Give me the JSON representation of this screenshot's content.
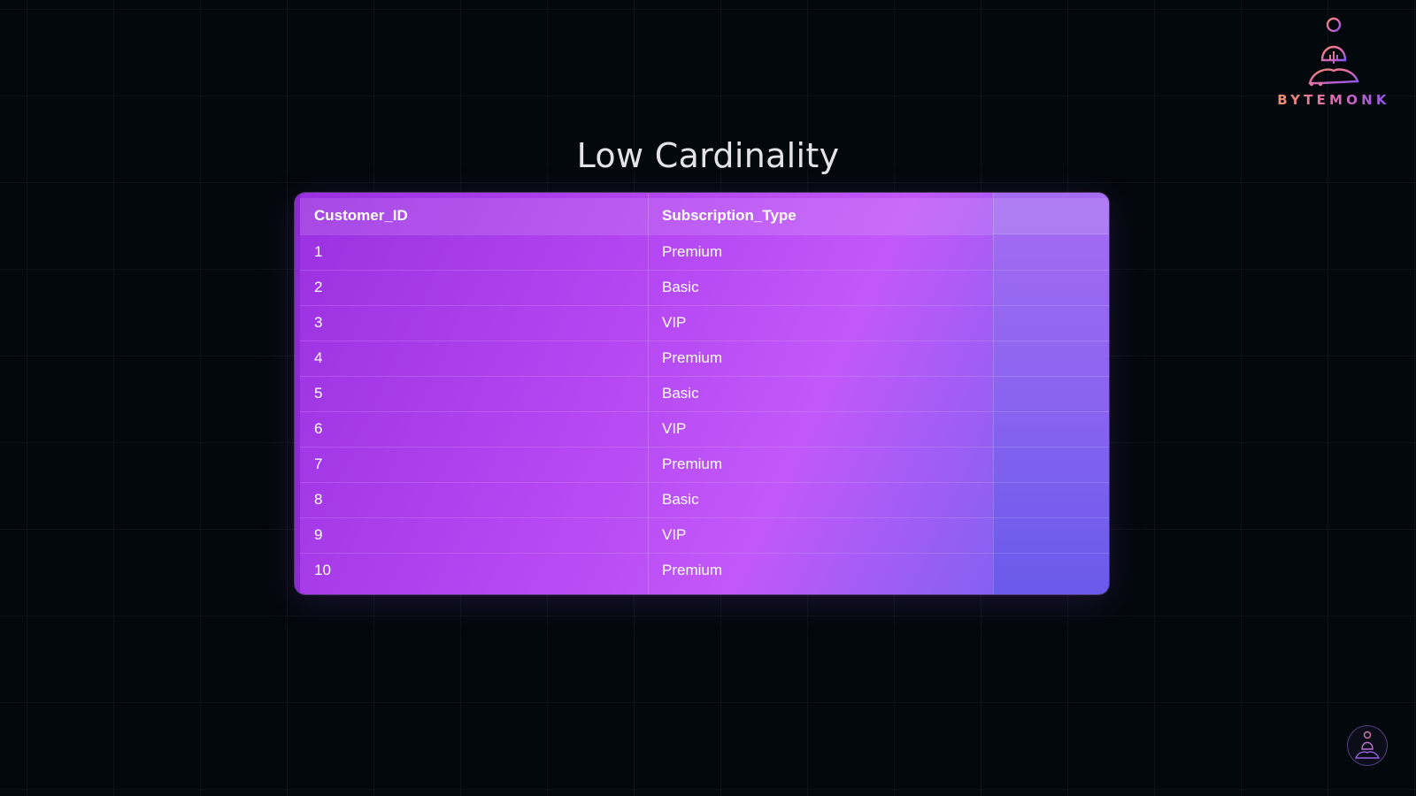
{
  "brand": {
    "wordmark": "BYTEMONK",
    "logo_icon": "meditating-monk-icon",
    "colors": [
      "#f0906a",
      "#e06ab0",
      "#8a55f0"
    ]
  },
  "title": "Low Cardinality",
  "table": {
    "columns": [
      "Customer_ID",
      "Subscription_Type"
    ],
    "rows": [
      [
        "1",
        "Premium"
      ],
      [
        "2",
        "Basic"
      ],
      [
        "3",
        "VIP"
      ],
      [
        "4",
        "Premium"
      ],
      [
        "5",
        "Basic"
      ],
      [
        "6",
        "VIP"
      ],
      [
        "7",
        "Premium"
      ],
      [
        "8",
        "Basic"
      ],
      [
        "9",
        "VIP"
      ],
      [
        "10",
        "Premium"
      ]
    ],
    "accent_color": "#b548f2"
  },
  "avatar": {
    "icon": "monk-avatar-icon"
  }
}
